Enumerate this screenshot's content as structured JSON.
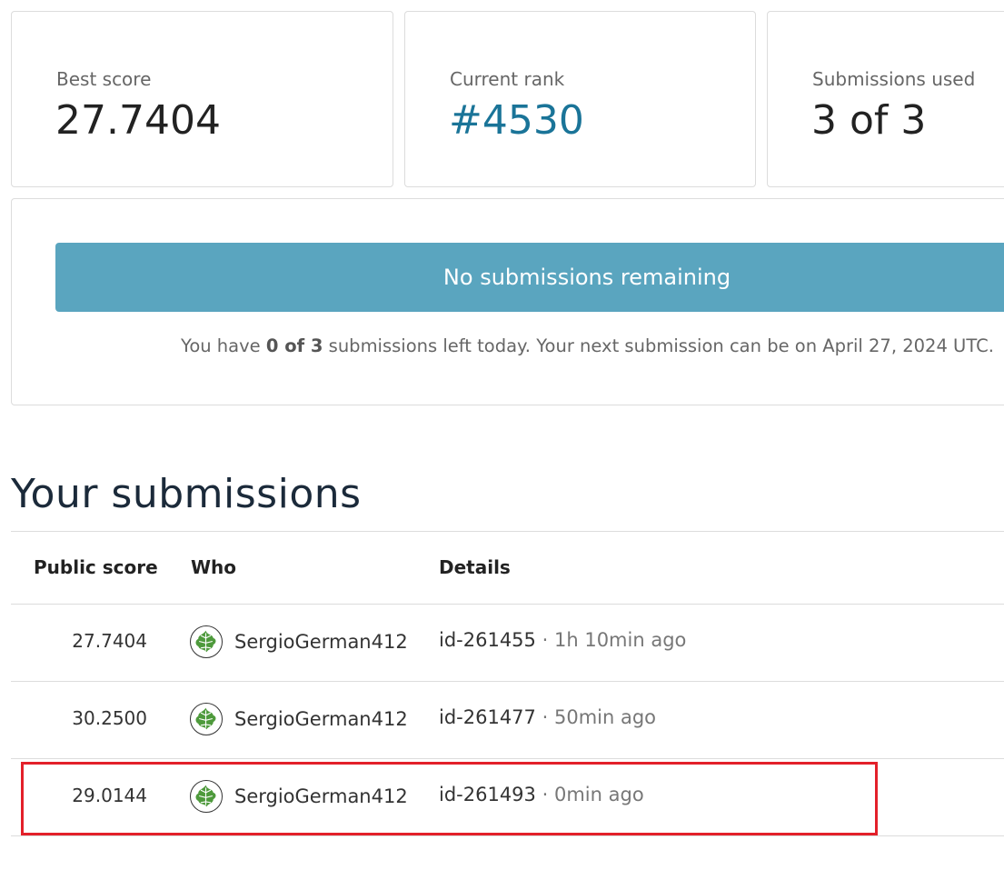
{
  "stats": {
    "best_score": {
      "label": "Best score",
      "value": "27.7404"
    },
    "current_rank": {
      "label": "Current rank",
      "value": "#4530"
    },
    "submissions_used": {
      "label": "Submissions used",
      "value": "3 of 3"
    }
  },
  "submission_panel": {
    "banner_label": "No submissions remaining",
    "note_prefix": "You have ",
    "note_count": "0 of 3",
    "note_suffix": " submissions left today. Your next submission can be on April 27, 2024 UTC."
  },
  "section_title": "Your submissions",
  "table": {
    "headers": {
      "score": "Public score",
      "who": "Who",
      "details": "Details"
    },
    "rows": [
      {
        "score": "27.7404",
        "who": "SergioGerman412",
        "id": "id-261455",
        "separator": "·",
        "time": "1h 10min ago"
      },
      {
        "score": "30.2500",
        "who": "SergioGerman412",
        "id": "id-261477",
        "separator": "·",
        "time": "50min ago"
      },
      {
        "score": "29.0144",
        "who": "SergioGerman412",
        "id": "id-261493",
        "separator": "·",
        "time": "0min ago"
      }
    ]
  },
  "colors": {
    "accent": "#1a7498",
    "banner": "#5aa5bf",
    "highlight": "#e3202a",
    "avatar": "#4e9a3c"
  },
  "icons": {
    "avatar": "leaf-avatar-icon"
  }
}
